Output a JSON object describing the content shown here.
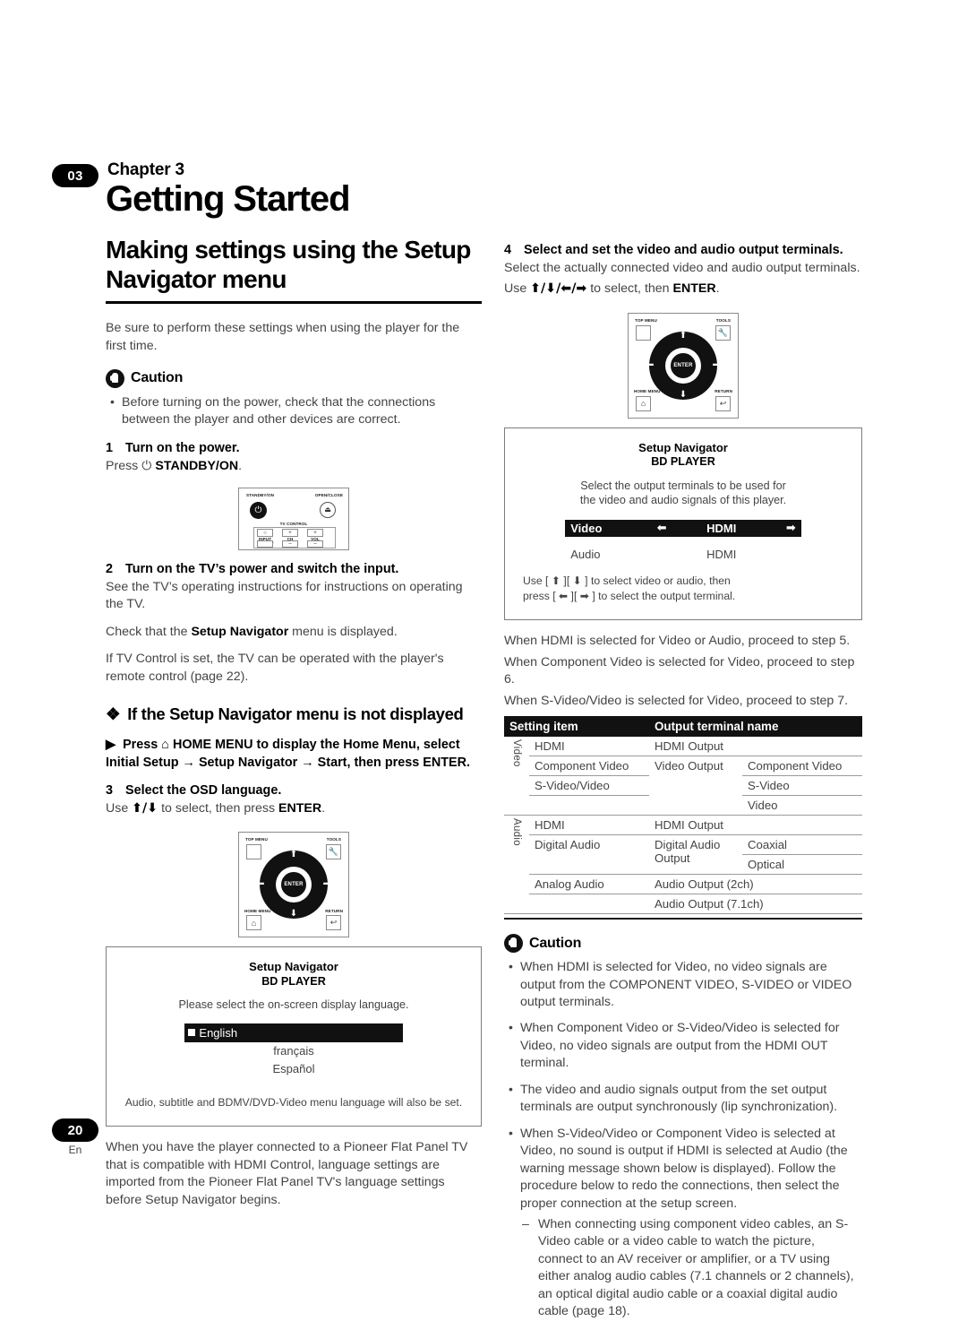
{
  "header": {
    "chapter_number": "03",
    "chapter_label": "Chapter 3",
    "chapter_title": "Getting Started"
  },
  "left": {
    "section_title": "Making settings using the Setup Navigator menu",
    "intro": "Be sure to perform these settings when using the player for the first time.",
    "caution_label": "Caution",
    "caution_bullet_1": "Before turning on the power, check that the connections between the player and other devices are correct.",
    "step1_num": "1",
    "step1_title": "Turn on the power.",
    "step1_body_pre": "Press ",
    "step1_body_power": "⏻",
    "step1_body_bold": "STANDBY/ON",
    "step1_body_post": ".",
    "step2_num": "2",
    "step2_title": "Turn on the TV’s power and switch the input.",
    "step2_body_1": "See the TV’s operating instructions for instructions on operating the TV.",
    "step2_body_2_pre": "Check that the ",
    "step2_body_2_bold": "Setup Navigator",
    "step2_body_2_post": " menu is displayed.",
    "step2_body_3": "If TV Control is set, the TV can be operated with the player's remote control (page 22).",
    "subhead": "If the Setup Navigator menu is not displayed",
    "arrow_item": "Press ⌂ HOME MENU to display the Home Menu, select Initial Setup → Setup Navigator → Start, then press ENTER.",
    "step3_num": "3",
    "step3_title": "Select the OSD language.",
    "step3_body_pre": "Use ",
    "step3_body_keys": "⬆/⬇",
    "step3_body_mid": " to select, then press ",
    "step3_body_bold": "ENTER",
    "step3_body_post": ".",
    "closing": "When you have the player connected to a Pioneer Flat Panel TV that is compatible with HDMI Control, language settings are imported from the Pioneer Flat Panel TV's language settings before Setup Navigator begins."
  },
  "remote_top": {
    "standby_label": "STANDBY/ON",
    "open_close_label": "OPEN/CLOSE",
    "tv_control_label": "TV CONTROL",
    "input_select_label": "INPUT SELECT",
    "ch_label": "CH",
    "vol_label": "VOL",
    "plus": "+",
    "minus": "–",
    "power_glyph": "⏻",
    "eject_glyph": "⏏"
  },
  "remote_dpad": {
    "top_menu_label": "TOP MENU",
    "tools_label": "TOOLS",
    "home_menu_label": "HOME MENU",
    "return_label": "RETURN",
    "enter_label": "ENTER",
    "up": "⬆",
    "down": "⬇",
    "left": "⬅",
    "right": "➡",
    "tools_glyph": "ὒ7",
    "home_glyph": "⌂",
    "return_glyph": "↩"
  },
  "osd_language": {
    "title": "Setup Navigator",
    "subtitle": "BD PLAYER",
    "prompt": "Please select the on-screen display language.",
    "options": [
      "English",
      "français",
      "Español"
    ],
    "selected_index": 0,
    "footer": "Audio, subtitle and BDMV/DVD-Video menu language will also be set."
  },
  "right": {
    "step4_num": "4",
    "step4_title": "Select and set the video and audio output terminals.",
    "step4_body_1": "Select the actually connected video and audio output terminals.",
    "step4_body_2_pre": "Use ",
    "step4_body_2_keys": "⬆/⬇/⬅/➡",
    "step4_body_2_mid": " to select, then ",
    "step4_body_2_bold": "ENTER",
    "step4_body_2_post": ".",
    "proceed_1": "When HDMI is selected for Video or Audio, proceed to step 5.",
    "proceed_2": "When Component Video is selected for Video, proceed to step 6.",
    "proceed_3": "When S-Video/Video is selected for Video, proceed to step 7.",
    "caution_label": "Caution",
    "caution_bullet_1": "When HDMI is selected for Video, no video signals are output from the COMPONENT VIDEO, S-VIDEO or VIDEO output terminals.",
    "caution_bullet_2": "When Component Video or S-Video/Video is selected for Video, no video signals are output from the HDMI OUT terminal.",
    "caution_bullet_3": "The video and audio signals output from the set output terminals are output synchronously (lip synchronization).",
    "caution_bullet_4": "When S-Video/Video or Component Video is selected at Video, no sound is output if HDMI is selected at Audio (the warning message shown below is displayed). Follow the procedure below to redo the connections, then select the proper connection at the setup screen.",
    "dash_item_1": "When connecting using component video cables, an S-Video cable or a video cable to watch the picture, connect to an AV receiver or amplifier, or a TV using either analog audio cables (7.1 channels or 2 channels), an optical digital audio cable or a coaxial digital audio cable (page 18)."
  },
  "osd_terminals": {
    "title": "Setup Navigator",
    "subtitle": "BD PLAYER",
    "prompt_line1": "Select the output terminals to be used for",
    "prompt_line2": "the video and audio signals of this player.",
    "row_video_label": "Video",
    "row_video_value": "HDMI",
    "row_audio_label": "Audio",
    "row_audio_value": "HDMI",
    "left_arrow": "⬅",
    "right_arrow": "➡",
    "help_line1": "Use [ ⬆ ][ ⬇ ] to select video or audio, then",
    "help_line2": "press [ ⬅ ][ ➡ ] to select the output terminal."
  },
  "table": {
    "headers": [
      "Setting item",
      "Output terminal name"
    ],
    "groups": [
      {
        "label": "Video",
        "rows": [
          {
            "setting": "HDMI",
            "terminal": "HDMI Output",
            "sub": ""
          },
          {
            "setting": "Component Video",
            "terminal": "Video Output",
            "sub": "Component Video"
          },
          {
            "setting": "S-Video/Video",
            "terminal": "",
            "sub": "S-Video"
          },
          {
            "setting": "",
            "terminal": "",
            "sub": "Video"
          }
        ]
      },
      {
        "label": "Audio",
        "rows": [
          {
            "setting": "HDMI",
            "terminal": "HDMI Output",
            "sub": ""
          },
          {
            "setting": "Digital Audio",
            "terminal": "Digital Audio Output",
            "sub": "Coaxial"
          },
          {
            "setting": "",
            "terminal": "",
            "sub": "Optical"
          },
          {
            "setting": "Analog Audio",
            "terminal": "Audio Output (2ch)",
            "sub": ""
          },
          {
            "setting": "",
            "terminal": "Audio Output (7.1ch)",
            "sub": ""
          }
        ]
      }
    ]
  },
  "footer": {
    "page_number": "20",
    "language_code": "En"
  }
}
